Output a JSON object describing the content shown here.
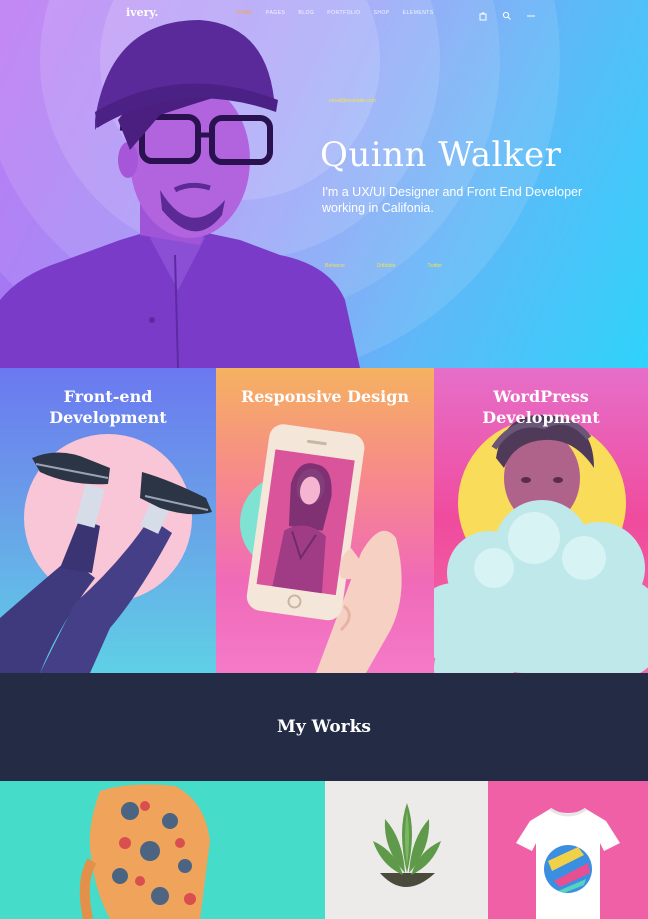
{
  "nav": {
    "logo": "ivery.",
    "items": [
      {
        "label": "Home",
        "active": true
      },
      {
        "label": "Pages",
        "active": false
      },
      {
        "label": "Blog",
        "active": false
      },
      {
        "label": "Portfolio",
        "active": false
      },
      {
        "label": "Shop",
        "active": false
      },
      {
        "label": "Elements",
        "active": false
      }
    ],
    "icons": [
      "cart-icon",
      "search-icon",
      "menu-icon"
    ]
  },
  "hero": {
    "email": "email@example.com",
    "name": "Quinn Walker",
    "subtitle": "I'm a UX/UI Designer and Front End Developer working in Califonia.",
    "social": [
      "Behance",
      "Dribbble",
      "Twitter"
    ]
  },
  "services": [
    {
      "title": "Front-end Development"
    },
    {
      "title": "Responsive Design"
    },
    {
      "title": "WordPress Development"
    }
  ],
  "works": {
    "title": "My Works"
  },
  "colors": {
    "accent": "#f7a53b",
    "yellow": "#f5e24a",
    "dark": "#232b45",
    "teal": "#45dcc9",
    "pink": "#f060a6"
  }
}
